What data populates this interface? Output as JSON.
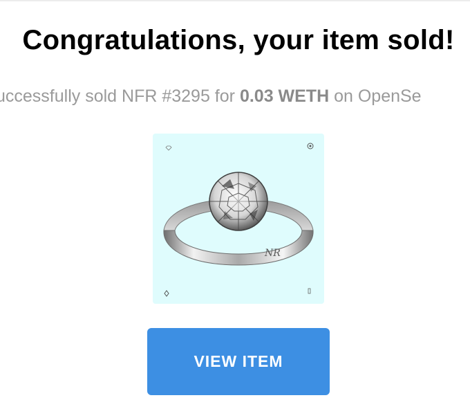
{
  "headline": "Congratulations, your item sold!",
  "sale": {
    "prefix": "uccessfully sold NFR #3295 for ",
    "amount": "0.03 WETH",
    "suffix": " on OpenSe"
  },
  "nft": {
    "image": "diamond-solitaire-ring",
    "engraving": "NR",
    "corner_icons": [
      "diamond-icon",
      "sparkle-icon",
      "rhombus-icon",
      "bar-icon"
    ]
  },
  "actions": {
    "view_label": "VIEW ITEM"
  },
  "colors": {
    "card_background": "#dffcfd",
    "button": "#3d8fe3",
    "button_text": "#ffffff",
    "subtitle": "#9a9a9a"
  }
}
